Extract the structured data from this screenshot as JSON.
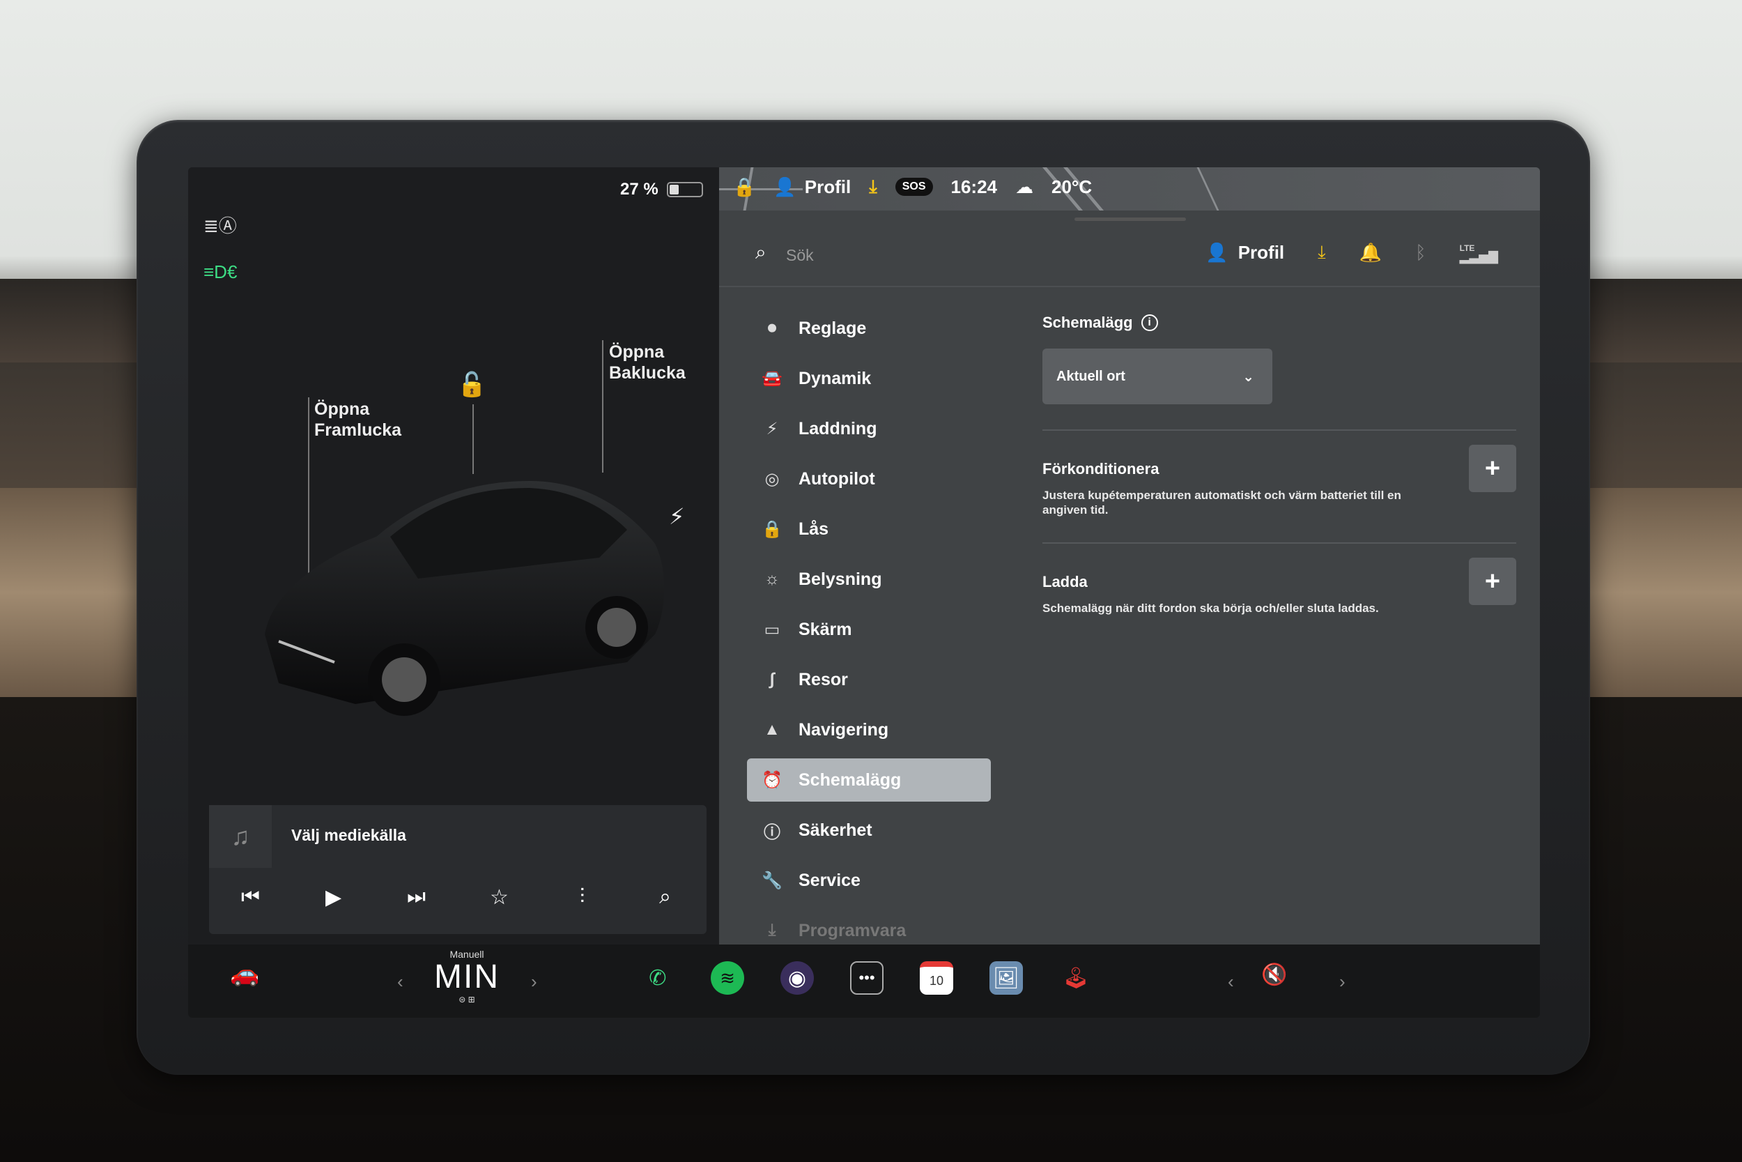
{
  "left_panel": {
    "battery_percent": "27 %",
    "battery_level": 0.27,
    "label_front_trunk": "Öppna\nFramlucka",
    "label_rear_trunk": "Öppna\nBaklucka",
    "media": {
      "source_label": "Välj mediekälla"
    }
  },
  "status_bar": {
    "profile": "Profil",
    "time": "16:24",
    "temperature": "20°C",
    "sos": "SOS"
  },
  "search": {
    "placeholder": "Sök"
  },
  "top_right": {
    "profile": "Profil",
    "lte": "LTE"
  },
  "menu": {
    "items": [
      {
        "label": "Reglage"
      },
      {
        "label": "Dynamik"
      },
      {
        "label": "Laddning"
      },
      {
        "label": "Autopilot"
      },
      {
        "label": "Lås"
      },
      {
        "label": "Belysning"
      },
      {
        "label": "Skärm"
      },
      {
        "label": "Resor"
      },
      {
        "label": "Navigering"
      },
      {
        "label": "Schemalägg"
      },
      {
        "label": "Säkerhet"
      },
      {
        "label": "Service"
      },
      {
        "label": "Programvara"
      }
    ],
    "active": "Schemalägg"
  },
  "content": {
    "title": "Schemalägg",
    "location_select": "Aktuell ort",
    "precondition": {
      "title": "Förkonditionera",
      "desc": "Justera kupétemperaturen automatiskt och värm batteriet till en angiven tid."
    },
    "charge": {
      "title": "Ladda",
      "desc": "Schemalägg när ditt fordon ska börja och/eller sluta laddas."
    }
  },
  "taskbar": {
    "gear_mode": "Manuell",
    "climate": "MIN",
    "calendar_day": "10"
  },
  "colors": {
    "accent_download": "#f5c518",
    "headlight_green": "#3ddc84",
    "spotify_green": "#1db954",
    "phone_green": "#3ddc84"
  }
}
